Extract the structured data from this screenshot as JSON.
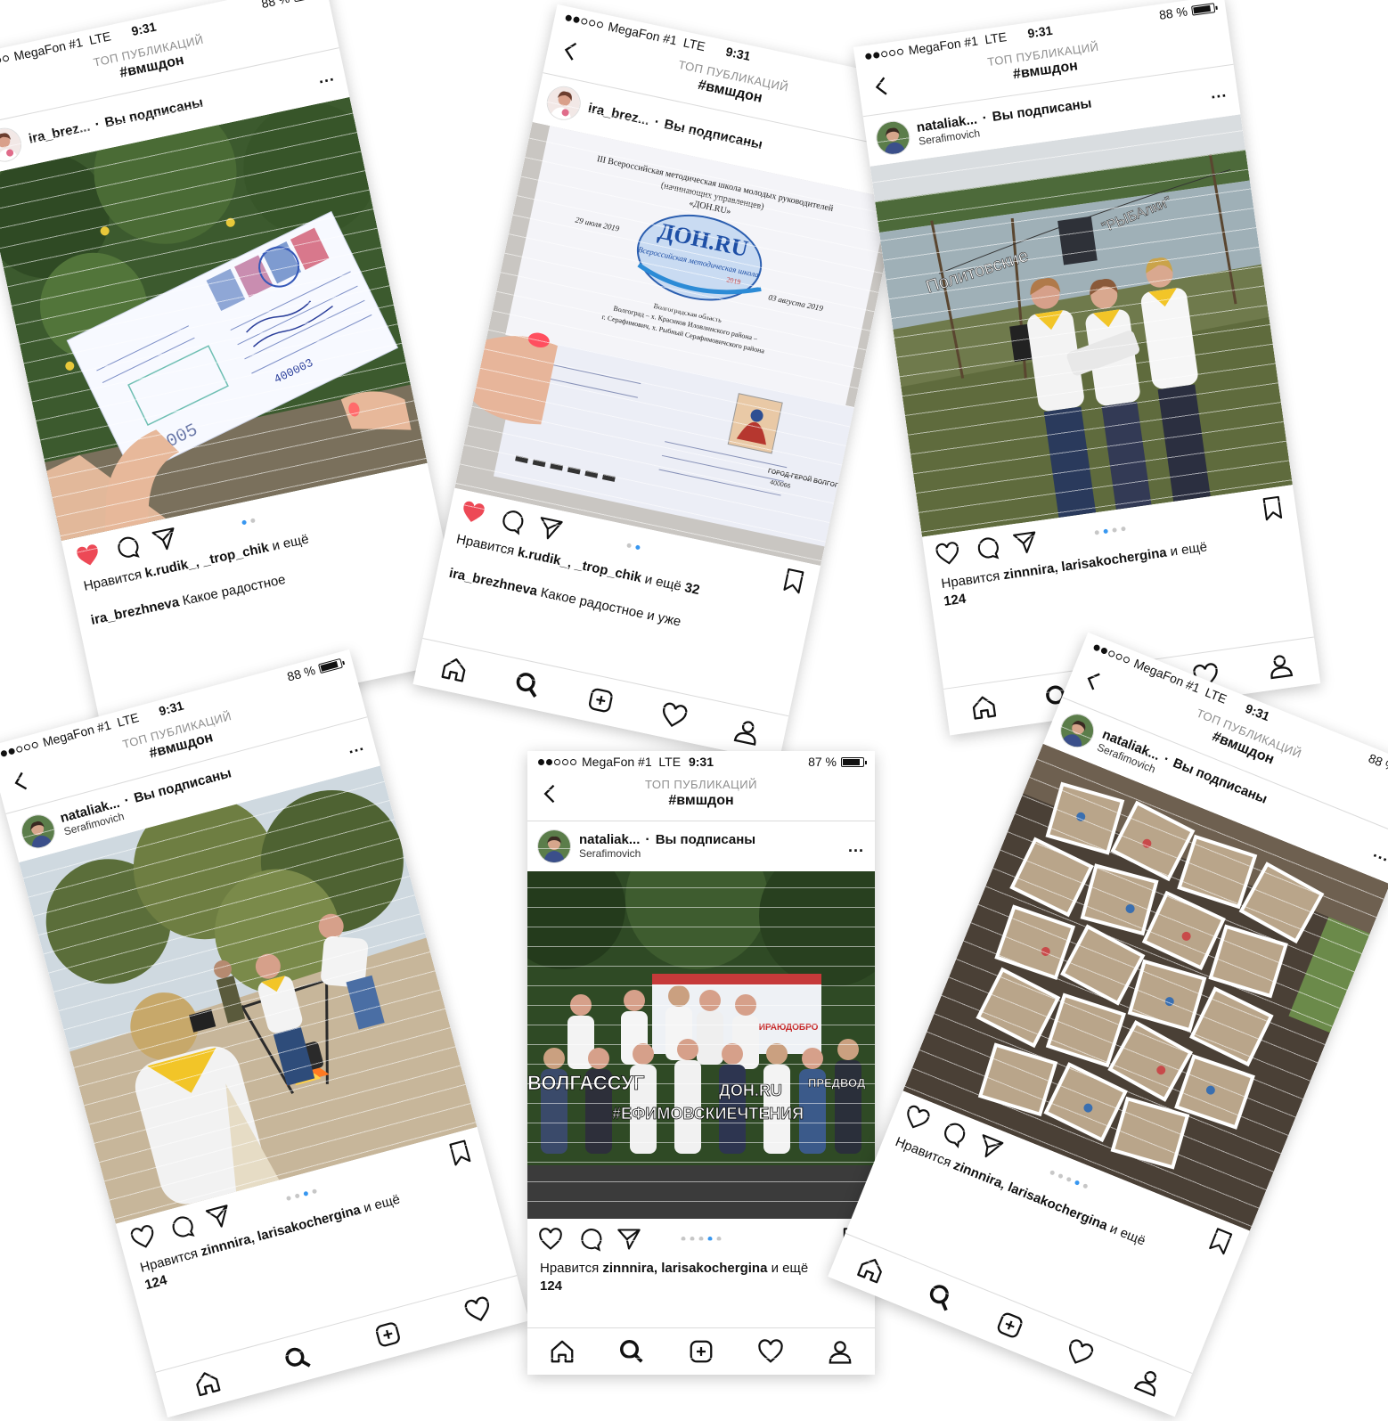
{
  "app": {
    "carrier": "MegaFon #1",
    "network": "LTE",
    "time": "9:31",
    "header_sub": "ТОП ПУБЛИКАЦИЙ",
    "header_tag": "#вмшдон",
    "follow": "Вы подписаны",
    "likes_prefix": "Нравится",
    "likes_and": "и ещё",
    "more": "..."
  },
  "colors": {
    "like_red": "#ed4956",
    "dot_active": "#3897f0",
    "dot_inactive": "#c7c7c7",
    "divider": "#dbdbdb"
  },
  "icons": [
    "back-chevron-icon",
    "heart-icon",
    "comment-icon",
    "share-icon",
    "bookmark-icon",
    "home-icon",
    "search-icon",
    "add-post-icon",
    "activity-heart-icon",
    "profile-icon",
    "battery-icon"
  ],
  "posts": [
    {
      "battery": "88 %",
      "username": "ira_brez...",
      "location": "",
      "liked": true,
      "dots": 2,
      "active_dot": 0,
      "likes_users": "k.rudik_, _trop_chik",
      "likes_count": "",
      "caption_user": "ira_brezhneva",
      "caption_text": "Какое радостное",
      "photo_texts": [
        "400005",
        "400003"
      ]
    },
    {
      "battery": "",
      "username": "ira_brez...",
      "location": "",
      "liked": true,
      "dots": 2,
      "active_dot": 1,
      "likes_users": "k.rudik_, _trop_chik",
      "likes_count": "32",
      "caption_user": "ira_brezhneva",
      "caption_text": "Какое радостное и уже",
      "photo_texts": [
        "III Всероссийская методическая школа молодых руководителей",
        "(начинающих управленцев)",
        "«ДОН.RU»",
        "ДОН.RU",
        "Всероссийская методическая школа",
        "2019",
        "29 июля 2019",
        "03 августа 2019",
        "Волгоград – х. Красиков Иловлинского района –",
        "г. Серафимович, х. Рыбный Серафимовичского района",
        "Волгоградская область",
        "ГОРОД-ГЕРОЙ ВОЛГОГРАД",
        "400066"
      ]
    },
    {
      "battery": "88 %",
      "username": "nataliak...",
      "location": "Serafimovich",
      "liked": false,
      "dots": 4,
      "active_dot": 1,
      "likes_users": "zinnnira, larisakochergina",
      "likes_count": "124",
      "caption_user": "",
      "caption_text": "",
      "photo_texts": [
        "Политовские",
        "\"РЫБАлки\""
      ]
    },
    {
      "battery": "88 %",
      "username": "nataliak...",
      "location": "Serafimovich",
      "liked": false,
      "dots": 4,
      "active_dot": 2,
      "likes_users": "zinnnira, larisakochergina",
      "likes_count": "124",
      "caption_user": "",
      "caption_text": "",
      "photo_texts": []
    },
    {
      "battery": "87 %",
      "username": "nataliak...",
      "location": "Serafimovich",
      "liked": false,
      "dots": 5,
      "active_dot": 3,
      "likes_users": "zinnnira, larisakochergina",
      "likes_count": "124",
      "caption_user": "",
      "caption_text": "",
      "photo_texts": [
        "ВОЛГАССУГ",
        "#ЕФИМОВСКИЕЧТЕНИЯ",
        "ДОН.RU",
        "ПРЕДВОД",
        "#ВЫБИРАЮДОБРО"
      ]
    },
    {
      "battery": "88 %",
      "username": "nataliak...",
      "location": "Serafimovich",
      "liked": false,
      "dots": 5,
      "active_dot": 3,
      "likes_users": "zinnnira, larisakochergina",
      "likes_count": "",
      "caption_user": "",
      "caption_text": "",
      "photo_texts": []
    }
  ]
}
